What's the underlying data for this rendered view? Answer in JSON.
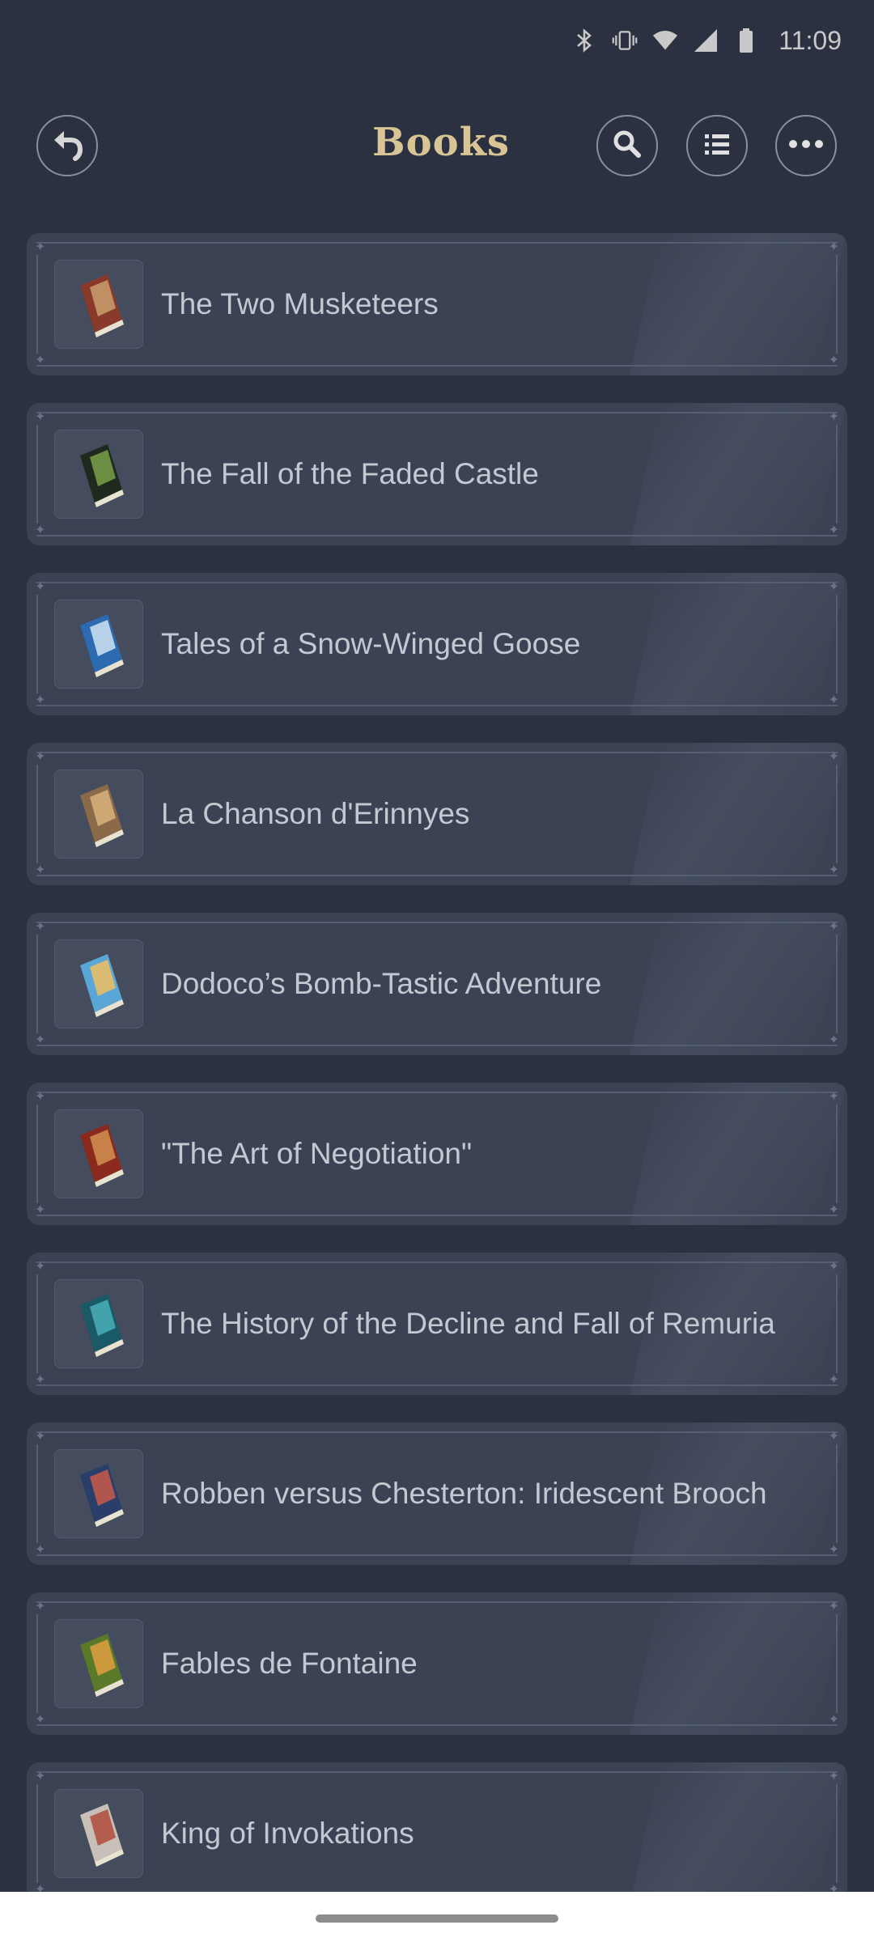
{
  "status_bar": {
    "time": "11:09",
    "icons": [
      "bluetooth-icon",
      "vibrate-icon",
      "wifi-icon",
      "signal-icon",
      "battery-icon"
    ]
  },
  "header": {
    "title": "Books",
    "buttons": [
      "back-icon",
      "search-icon",
      "list-icon",
      "more-icon"
    ]
  },
  "books": [
    {
      "title": "The Two Musketeers",
      "cover": [
        "#8a3a2a",
        "#c9a070"
      ]
    },
    {
      "title": "The Fall of the Faded Castle",
      "cover": [
        "#1f2a1e",
        "#7aa04a"
      ]
    },
    {
      "title": "Tales of a Snow-Winged Goose",
      "cover": [
        "#2c6bb0",
        "#cfe3f2"
      ]
    },
    {
      "title": "La Chanson d'Erinnyes",
      "cover": [
        "#8a6a48",
        "#d8b37c"
      ]
    },
    {
      "title": "Dodoco’s Bomb-Tastic Adventure",
      "cover": [
        "#5aa6d6",
        "#f0c060"
      ]
    },
    {
      "title": "\"The Art of Negotiation\"",
      "cover": [
        "#8a2a1e",
        "#d29050"
      ]
    },
    {
      "title": "The History of the Decline and Fall of Remuria",
      "cover": [
        "#1a5a66",
        "#4ab0b8"
      ]
    },
    {
      "title": "Robben versus Chesterton: Iridescent Brooch",
      "cover": [
        "#2a3e6a",
        "#c85a4a"
      ]
    },
    {
      "title": "Fables de Fontaine",
      "cover": [
        "#5a7a2a",
        "#e0a040"
      ]
    },
    {
      "title": "King of Invokations",
      "cover": [
        "#c8c0b8",
        "#b04a3a"
      ]
    }
  ]
}
